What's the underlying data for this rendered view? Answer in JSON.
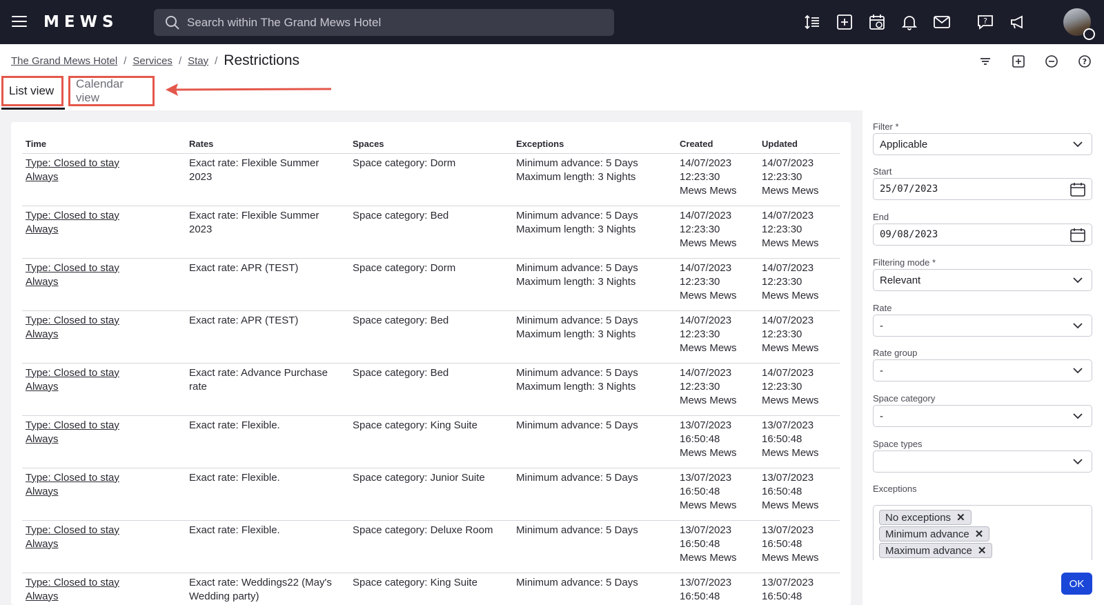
{
  "app": {
    "logo": "MEWS",
    "search_placeholder": "Search within The Grand Mews Hotel"
  },
  "breadcrumb": {
    "items": [
      "The Grand Mews Hotel",
      "Services",
      "Stay"
    ],
    "current": "Restrictions"
  },
  "tabs": {
    "list": "List view",
    "calendar": "Calendar view"
  },
  "table": {
    "headers": [
      "Time",
      "Rates",
      "Spaces",
      "Exceptions",
      "Created",
      "Updated"
    ],
    "rows": [
      {
        "time1": "Type: Closed to stay",
        "time2": "Always",
        "rate1": "Exact rate: Flexible Summer",
        "rate2": "2023",
        "space": "Space category: Dorm",
        "exc1": "Minimum advance: 5 Days",
        "exc2": "Maximum length: 3 Nights",
        "c_date": "14/07/2023",
        "c_time": "12:23:30",
        "c_user": "Mews Mews",
        "u_date": "14/07/2023",
        "u_time": "12:23:30",
        "u_user": "Mews Mews"
      },
      {
        "time1": "Type: Closed to stay",
        "time2": "Always",
        "rate1": "Exact rate: Flexible Summer",
        "rate2": "2023",
        "space": "Space category: Bed",
        "exc1": "Minimum advance: 5 Days",
        "exc2": "Maximum length: 3 Nights",
        "c_date": "14/07/2023",
        "c_time": "12:23:30",
        "c_user": "Mews Mews",
        "u_date": "14/07/2023",
        "u_time": "12:23:30",
        "u_user": "Mews Mews"
      },
      {
        "time1": "Type: Closed to stay",
        "time2": "Always",
        "rate1": "Exact rate: APR (TEST)",
        "rate2": "",
        "space": "Space category: Dorm",
        "exc1": "Minimum advance: 5 Days",
        "exc2": "Maximum length: 3 Nights",
        "c_date": "14/07/2023",
        "c_time": "12:23:30",
        "c_user": "Mews Mews",
        "u_date": "14/07/2023",
        "u_time": "12:23:30",
        "u_user": "Mews Mews"
      },
      {
        "time1": "Type: Closed to stay",
        "time2": "Always",
        "rate1": "Exact rate: APR (TEST)",
        "rate2": "",
        "space": "Space category: Bed",
        "exc1": "Minimum advance: 5 Days",
        "exc2": "Maximum length: 3 Nights",
        "c_date": "14/07/2023",
        "c_time": "12:23:30",
        "c_user": "Mews Mews",
        "u_date": "14/07/2023",
        "u_time": "12:23:30",
        "u_user": "Mews Mews"
      },
      {
        "time1": "Type: Closed to stay",
        "time2": "Always",
        "rate1": "Exact rate: Advance Purchase",
        "rate2": "rate",
        "space": "Space category: Bed",
        "exc1": "Minimum advance: 5 Days",
        "exc2": "Maximum length: 3 Nights",
        "c_date": "14/07/2023",
        "c_time": "12:23:30",
        "c_user": "Mews Mews",
        "u_date": "14/07/2023",
        "u_time": "12:23:30",
        "u_user": "Mews Mews"
      },
      {
        "time1": "Type: Closed to stay",
        "time2": "Always",
        "rate1": "Exact rate: Flexible.",
        "rate2": "",
        "space": "Space category: King Suite",
        "exc1": "Minimum advance: 5 Days",
        "exc2": "",
        "c_date": "13/07/2023",
        "c_time": "16:50:48",
        "c_user": "Mews Mews",
        "u_date": "13/07/2023",
        "u_time": "16:50:48",
        "u_user": "Mews Mews"
      },
      {
        "time1": "Type: Closed to stay",
        "time2": "Always",
        "rate1": "Exact rate: Flexible.",
        "rate2": "",
        "space": "Space category: Junior Suite",
        "exc1": "Minimum advance: 5 Days",
        "exc2": "",
        "c_date": "13/07/2023",
        "c_time": "16:50:48",
        "c_user": "Mews Mews",
        "u_date": "13/07/2023",
        "u_time": "16:50:48",
        "u_user": "Mews Mews"
      },
      {
        "time1": "Type: Closed to stay",
        "time2": "Always",
        "rate1": "Exact rate: Flexible.",
        "rate2": "",
        "space": "Space category: Deluxe Room",
        "exc1": "Minimum advance: 5 Days",
        "exc2": "",
        "c_date": "13/07/2023",
        "c_time": "16:50:48",
        "c_user": "Mews Mews",
        "u_date": "13/07/2023",
        "u_time": "16:50:48",
        "u_user": "Mews Mews"
      },
      {
        "time1": "Type: Closed to stay",
        "time2": "Always",
        "rate1": "Exact rate: Weddings22 (May's",
        "rate2": "Wedding party)",
        "space": "Space category: King Suite",
        "exc1": "Minimum advance: 5 Days",
        "exc2": "",
        "c_date": "13/07/2023",
        "c_time": "16:50:48",
        "c_user": "Mews Mews",
        "u_date": "13/07/2023",
        "u_time": "16:50:48",
        "u_user": "Mews Mews"
      }
    ]
  },
  "filters": {
    "filter_label": "Filter *",
    "filter_value": "Applicable",
    "start_label": "Start",
    "start_value": "25/07/2023",
    "end_label": "End",
    "end_value": "09/08/2023",
    "mode_label": "Filtering mode *",
    "mode_value": "Relevant",
    "rate_label": "Rate",
    "rate_value": "-",
    "rate_group_label": "Rate group",
    "rate_group_value": "-",
    "space_category_label": "Space category",
    "space_category_value": "-",
    "space_types_label": "Space types",
    "space_types_value": "",
    "exceptions_label": "Exceptions",
    "exceptions_chips": [
      "No exceptions",
      "Minimum advance",
      "Maximum advance"
    ],
    "ok_label": "OK"
  }
}
